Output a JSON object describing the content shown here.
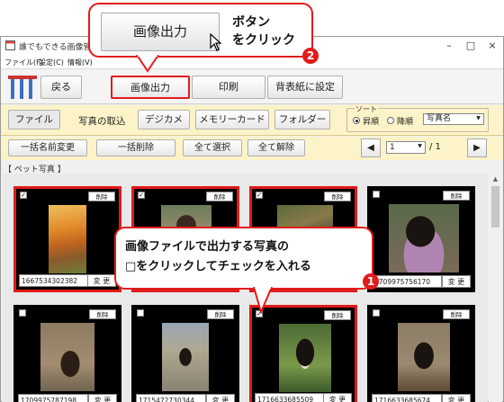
{
  "window": {
    "title": "誰でもできる画像管理mini",
    "controls": {
      "minimize": "–",
      "maximize": "□",
      "close": "×"
    }
  },
  "menu": [
    "ファイル(F)",
    "設定(C)",
    "情報(V)"
  ],
  "toolbar": {
    "back": "戻る",
    "print_image": "画像出力",
    "print": "印刷",
    "wallpaper": "背表紙に設定"
  },
  "import_bar": {
    "file_tab": "ファイル",
    "import_label": "写真の取込",
    "camera": "デジカメ",
    "memory_card": "メモリーカード",
    "folder": "フォルダー",
    "sort": {
      "title": "ソート",
      "ascending": "昇順",
      "descending": "降順",
      "selected_order": "ascending",
      "sort_key": "写真名"
    }
  },
  "action_bar": {
    "batch_rename": "一括名前変更",
    "batch_delete": "一括削除",
    "select_all": "全て選択",
    "deselect_all": "全て解除",
    "page_current": "1",
    "page_total": "/ 1",
    "prev": "◀",
    "next": "▶"
  },
  "album": {
    "label": "【 ペット写真 】"
  },
  "photos": [
    {
      "name": "1667534302382",
      "checked": true,
      "selected": true
    },
    {
      "name": "",
      "checked": true,
      "selected": true
    },
    {
      "name": "",
      "checked": true,
      "selected": true
    },
    {
      "name": "1709975756170",
      "checked": false,
      "selected": false
    },
    {
      "name": "1709975787198",
      "checked": false,
      "selected": false
    },
    {
      "name": "1715472730344",
      "checked": false,
      "selected": false
    },
    {
      "name": "1716633685509",
      "checked": true,
      "selected": true
    },
    {
      "name": "1716633685674",
      "checked": false,
      "selected": false
    }
  ],
  "card_labels": {
    "delete": "削除",
    "change": "変 更"
  },
  "callout_top": {
    "button_text": "画像出力",
    "line1": "ボタン",
    "line2": "をクリック",
    "step": "2"
  },
  "callout_mid": {
    "line1": "画像ファイルで出力する写真の",
    "line2": "□をクリックしてチェックを入れる",
    "step": "1"
  },
  "colors": {
    "accent_red": "#e21b1b",
    "toolbar_yellow": "#fdf3c8"
  }
}
